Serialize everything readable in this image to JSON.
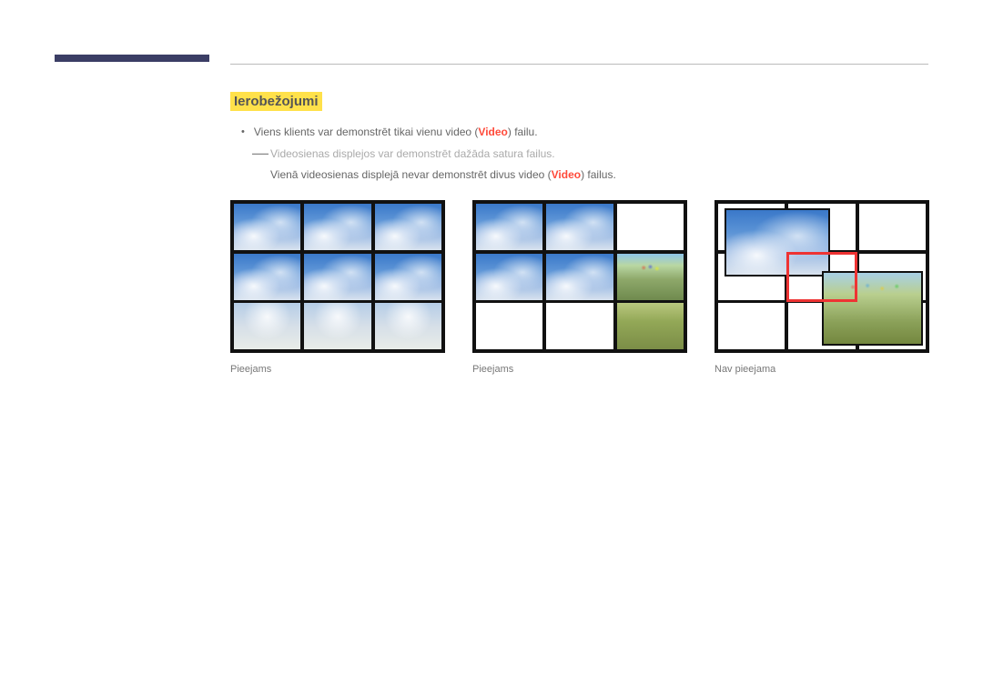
{
  "heading": "Ierobežojumi",
  "bullet1_a": "Viens klients var demonstrēt tikai vienu video (",
  "bullet1_video": "Video",
  "bullet1_b": ") failu.",
  "dash_line": "Videosienas displejos var demonstrēt dažāda satura failus.",
  "subline_a": "Vienā videosienas displejā nevar demonstrēt divus video (",
  "subline_video": "Video",
  "subline_b": ") failus.",
  "captions": {
    "fig1": "Pieejams",
    "fig2": "Pieejams",
    "fig3": "Nav pieejama"
  }
}
